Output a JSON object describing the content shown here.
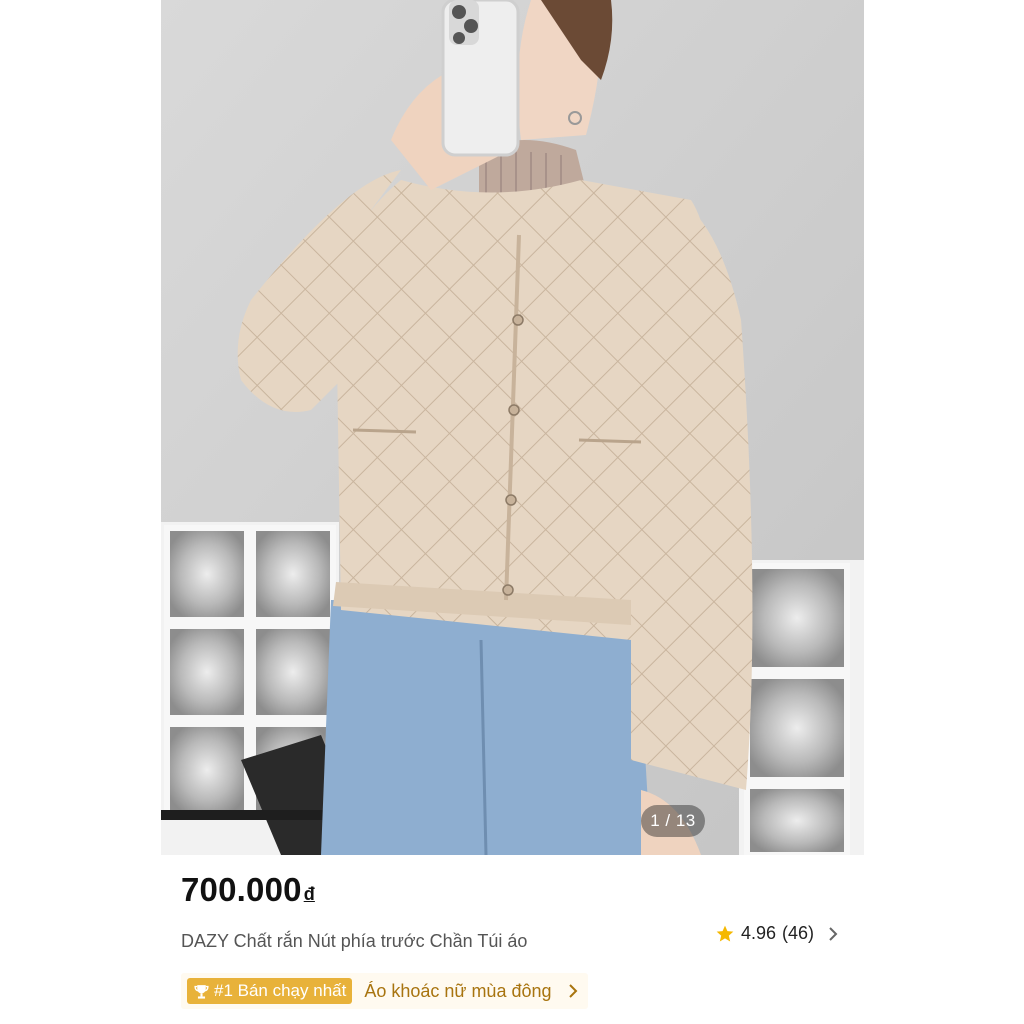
{
  "gallery": {
    "counter": "1 / 13"
  },
  "product": {
    "price": "700.000",
    "currency": "đ",
    "title": "DAZY Chất rắn Nút phía trước Chần Túi áo",
    "rating": "4.96",
    "review_count": "(46)"
  },
  "ranking": {
    "badge": "#1 Bán chạy nhất",
    "category": "Áo khoác nữ mùa đông"
  },
  "icons": {
    "star": "star-icon",
    "trophy": "trophy-icon",
    "chevron": "chevron-right-icon"
  },
  "colors": {
    "badge": "#e8b23a",
    "category_text": "#a8740f",
    "star": "#f5b800",
    "jacket": "#e6d6c3",
    "jeans": "#8eaed0"
  }
}
